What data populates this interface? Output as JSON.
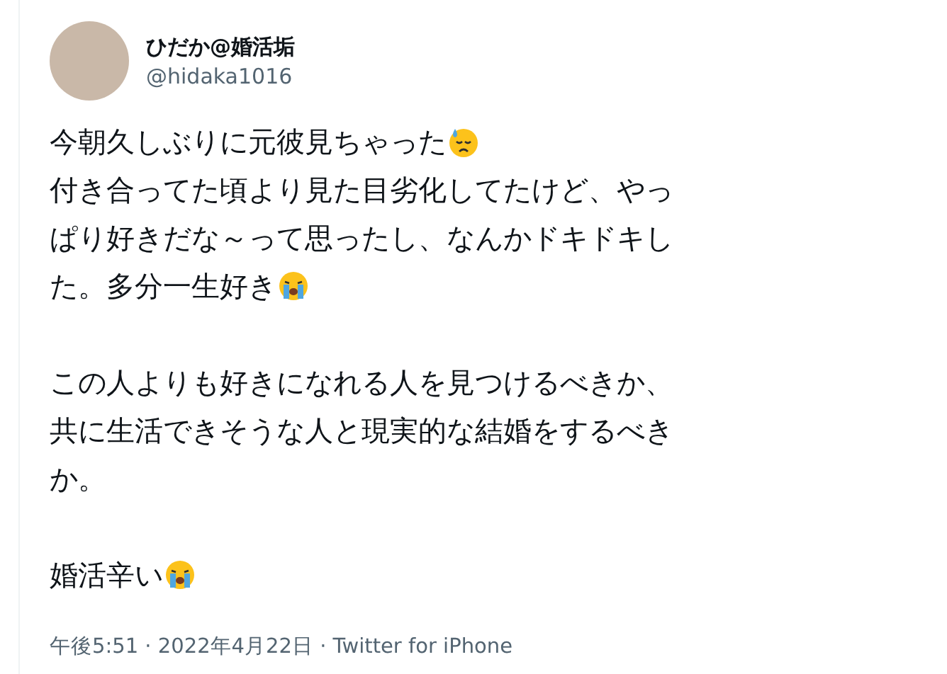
{
  "author": {
    "name": "ひだか@婚活垢",
    "handle": "@hidaka1016"
  },
  "body": [
    [
      [
        {
          "kind": "text",
          "text": "今朝久しぶりに元彼見ちゃった"
        },
        {
          "kind": "sweat-emoji"
        }
      ],
      [
        {
          "kind": "text",
          "text": "付き合ってた頃より見た目劣化してたけど、やっ"
        }
      ],
      [
        {
          "kind": "text",
          "text": "ぱり好きだな～って思ったし、なんかドキドキし"
        }
      ],
      [
        {
          "kind": "text",
          "text": "た。多分一生好き"
        },
        {
          "kind": "crying-emoji"
        }
      ]
    ],
    [
      [
        {
          "kind": "text",
          "text": "この人よりも好きになれる人を見つけるべきか、"
        }
      ],
      [
        {
          "kind": "text",
          "text": "共に生活できそうな人と現実的な結婚をするべき"
        }
      ],
      [
        {
          "kind": "text",
          "text": "か。"
        }
      ]
    ],
    [
      [
        {
          "kind": "text",
          "text": "婚活辛い"
        },
        {
          "kind": "crying-emoji"
        }
      ]
    ]
  ],
  "meta": "午後5:51 · 2022年4月22日 · Twitter for iPhone"
}
